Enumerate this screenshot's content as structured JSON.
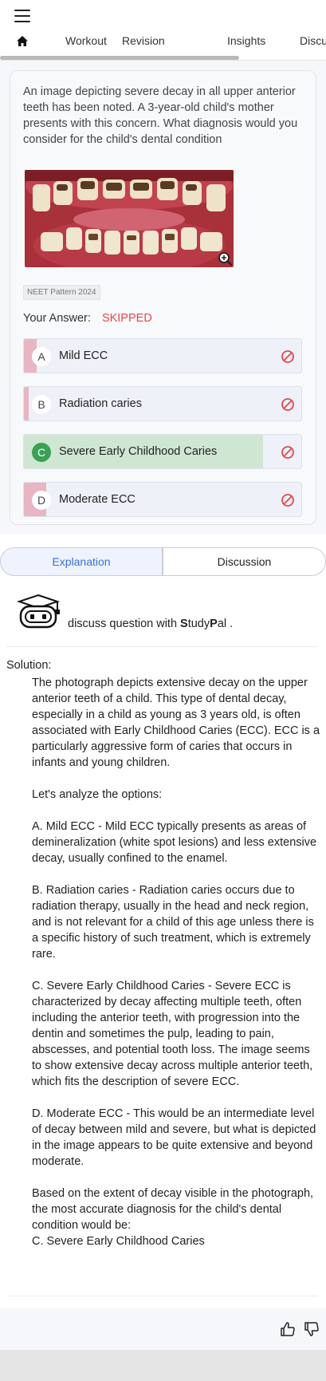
{
  "nav": {
    "tabs": [
      "Workout",
      "Revision",
      "Insights",
      "Discu"
    ]
  },
  "question": {
    "text": "An image depicting severe decay in all upper anterior teeth has been noted. A 3-year-old child's mother presents with this concern. What diagnosis would you consider for the child's dental condition",
    "tag": "NEET Pattern 2024",
    "your_answer_label": "Your Answer:",
    "your_answer_value": "SKIPPED",
    "options": [
      {
        "letter": "A",
        "label": "Mild ECC"
      },
      {
        "letter": "B",
        "label": "Radiation caries"
      },
      {
        "letter": "C",
        "label": "Severe Early Childhood Caries"
      },
      {
        "letter": "D",
        "label": "Moderate ECC"
      }
    ]
  },
  "switcher": {
    "explanation": "Explanation",
    "discussion": "Discussion"
  },
  "studypal": {
    "prefix": "discuss question with ",
    "s": "S",
    "tudy": "tudy",
    "p": "P",
    "al": "al ."
  },
  "solution": {
    "label": "Solution:",
    "paragraphs": [
      "The photograph depicts extensive decay on the upper anterior teeth of a child. This type of dental decay, especially in a child as young as 3 years old, is often associated with Early Childhood Caries (ECC). ECC is a particularly aggressive form of caries that occurs in infants and young children.",
      "Let's analyze the options:",
      "A. Mild ECC - Mild ECC typically presents as areas of demineralization (white spot lesions) and less extensive decay, usually confined to the enamel.",
      "B. Radiation caries - Radiation caries occurs due to radiation therapy, usually in the head and neck region, and is not relevant for a child of this age unless there is a specific history of such treatment, which is extremely rare.",
      "C. Severe Early Childhood Caries - Severe ECC is characterized by decay affecting multiple teeth, often including the anterior teeth, with progression into the dentin and sometimes the pulp, leading to pain, abscesses, and potential tooth loss. The image seems to show extensive decay across multiple anterior teeth, which fits the description of severe ECC.",
      "D. Moderate ECC - This would be an intermediate level of decay between mild and severe, but what is depicted in the image appears to be quite extensive and beyond moderate.",
      "Based on the extent of decay visible in the photograph, the most accurate diagnosis for the child's dental condition would be:",
      "C. Severe Early Childhood Caries"
    ]
  },
  "colors": {
    "accent": "#3b6fd6",
    "skipped": "#e5484d",
    "correct_fill": "#cfe6d3",
    "correct_badge": "#38a153",
    "wrong_bar": "#e8b5c3"
  },
  "icons": [
    "menu-icon",
    "home-icon",
    "zoom-in-icon",
    "ban-icon",
    "robot-icon",
    "thumbs-up-icon",
    "thumbs-down-icon"
  ]
}
